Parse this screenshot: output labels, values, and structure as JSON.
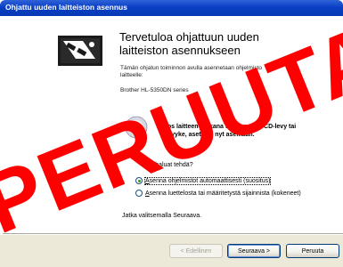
{
  "window": {
    "title": "Ohjattu uuden laitteiston asennus"
  },
  "main": {
    "heading_line1": "Tervetuloa ohjattuun uuden",
    "heading_line2": "laitteiston asennukseen",
    "intro_line1": "Tämän ohjatun toiminnon avulla asennetaan ohjelmisto",
    "intro_line2": "laitteelle:",
    "device_name": "Brother HL-5350DN series",
    "cd_line1": "Jos laitteen mukana tuli asennus-CD-levy tai",
    "cd_line2": "-levyke, aseta se nyt asemaan.",
    "question": "Mitä haluat tehdä?",
    "options": [
      {
        "label_accel": "A",
        "label_rest": "senna ohjelmistot automaattisesti (suositus)",
        "selected": true
      },
      {
        "label_accel": "A",
        "label_rest": "senna luettelosta tai määritetystä sijainnista (kokeneet)",
        "selected": false
      }
    ],
    "continue_text": "Jatka valitsemalla Seuraava."
  },
  "footer": {
    "back_label": "< Edellinen",
    "next_label": "Seuraava >",
    "cancel_label": "Peruuta"
  },
  "watermark": {
    "text": "PERUUTA",
    "color": "#ff0000"
  },
  "colors": {
    "titlebar": "#0a3fc4",
    "footer_bg": "#ece9d8"
  }
}
